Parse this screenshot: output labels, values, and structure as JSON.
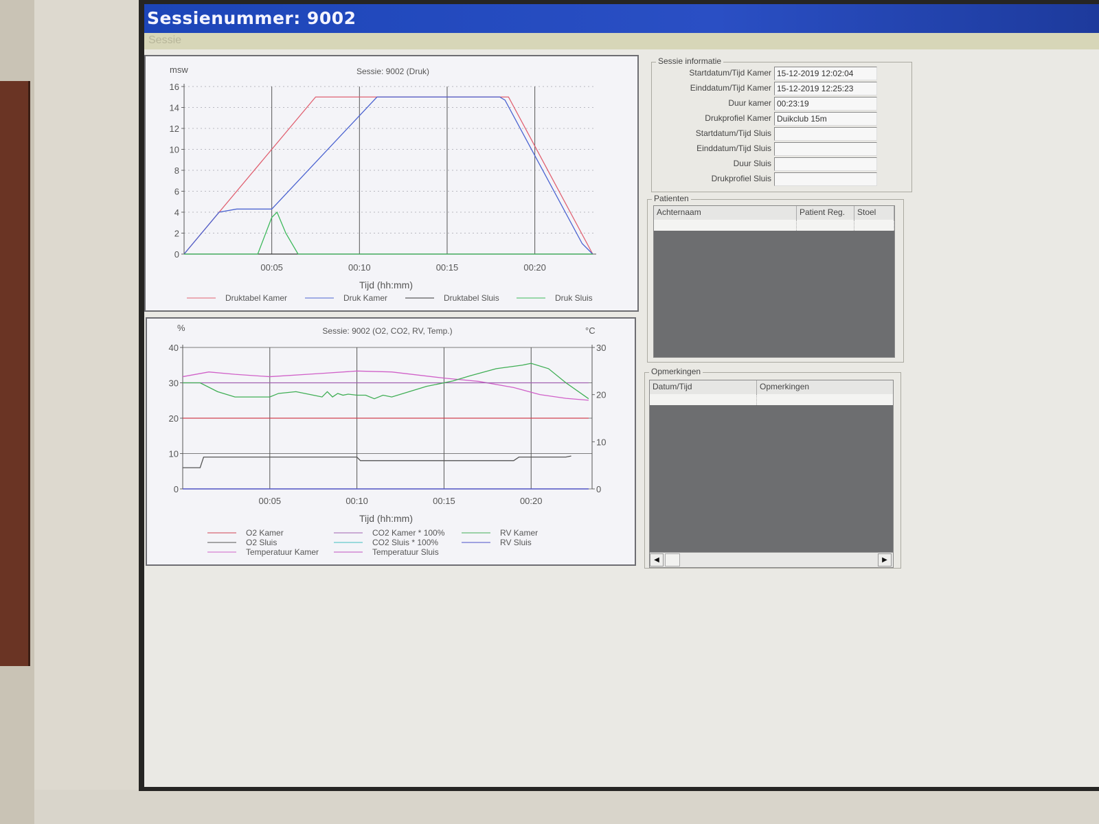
{
  "window": {
    "title": "Sessienummer: 9002"
  },
  "menu": {
    "items": [
      "Sessie"
    ]
  },
  "pressure_chart": {
    "title": "Sessie: 9002 (Druk)",
    "y_unit": "msw",
    "xlabel": "Tijd (hh:mm)",
    "y_ticks": [
      "0",
      "2",
      "4",
      "6",
      "8",
      "10",
      "12",
      "14",
      "16"
    ],
    "x_ticks": [
      "00:05",
      "00:10",
      "00:15",
      "00:20"
    ],
    "legend": [
      "Druktabel Kamer",
      "Druk Kamer",
      "Druktabel Sluis",
      "Druk Sluis"
    ]
  },
  "env_chart": {
    "title": "Sessie: 9002 (O2, CO2, RV, Temp.)",
    "y_unit_left": "%",
    "y_unit_right": "°C",
    "xlabel": "Tijd (hh:mm)",
    "y_ticks_left": [
      "0",
      "10",
      "20",
      "30",
      "40"
    ],
    "y_ticks_right": [
      "0",
      "10",
      "20",
      "30"
    ],
    "x_ticks": [
      "00:05",
      "00:10",
      "00:15",
      "00:20"
    ],
    "legend": [
      "O2 Kamer",
      "O2 Sluis",
      "Temperatuur Kamer",
      "CO2 Kamer * 100%",
      "CO2 Sluis * 100%",
      "Temperatuur Sluis",
      "RV Kamer",
      "RV Sluis"
    ]
  },
  "chart_data": [
    {
      "type": "line",
      "title": "Sessie: 9002 (Druk)",
      "xlabel": "Tijd (hh:mm)",
      "ylabel": "msw",
      "x_unit": "minutes",
      "xlim": [
        0,
        23.5
      ],
      "ylim": [
        0,
        16
      ],
      "grid": true,
      "legend_position": "bottom",
      "series": [
        {
          "name": "Druktabel Kamer",
          "color": "#e06070",
          "x": [
            0,
            7.5,
            18.5,
            23.3
          ],
          "y": [
            0,
            15,
            15,
            0
          ]
        },
        {
          "name": "Druk Kamer",
          "color": "#4a62d0",
          "x": [
            0,
            2,
            3,
            5,
            11,
            18,
            18.3,
            22.7,
            23.3
          ],
          "y": [
            0,
            4,
            4.3,
            4.3,
            15,
            15,
            14.7,
            1,
            0
          ]
        },
        {
          "name": "Druktabel Sluis",
          "color": "#333333",
          "x": [
            0,
            23.3
          ],
          "y": [
            0,
            0
          ]
        },
        {
          "name": "Druk Sluis",
          "color": "#3cb85a",
          "x": [
            0,
            4.2,
            5,
            5.3,
            5.8,
            6.5,
            23.3
          ],
          "y": [
            0,
            0,
            3.5,
            4,
            2,
            0,
            0
          ]
        }
      ]
    },
    {
      "type": "line",
      "title": "Sessie: 9002 (O2, CO2, RV, Temp.)",
      "xlabel": "Tijd (hh:mm)",
      "ylabel_left": "%",
      "ylabel_right": "°C",
      "x_unit": "minutes",
      "xlim": [
        0,
        23.5
      ],
      "ylim": [
        0,
        40
      ],
      "ylim_right": [
        0,
        30
      ],
      "grid": true,
      "legend_position": "bottom",
      "series": [
        {
          "name": "O2 Kamer",
          "color": "#d04050",
          "axis": "left",
          "x": [
            0,
            23.3
          ],
          "y": [
            20,
            20
          ]
        },
        {
          "name": "O2 Sluis",
          "color": "#555555",
          "axis": "left",
          "x": [
            0,
            1,
            1.2,
            10,
            10.2,
            19,
            19.3,
            22,
            22.3
          ],
          "y": [
            6,
            6,
            9,
            9,
            8,
            8,
            9,
            9,
            9.3
          ]
        },
        {
          "name": "Temperatuur Kamer",
          "color": "#d060c8",
          "axis": "right",
          "x": [
            0,
            1.5,
            3,
            5,
            8,
            10,
            12,
            15,
            17,
            19,
            20.5,
            22,
            23.3
          ],
          "y": [
            23.8,
            24.8,
            24.3,
            23.8,
            24.5,
            25,
            24.8,
            23.5,
            22.8,
            21.5,
            20,
            19.2,
            18.8
          ]
        },
        {
          "name": "CO2 Kamer * 100%",
          "color": "#a060b0",
          "axis": "left",
          "x": [
            0,
            23.3
          ],
          "y": [
            30,
            30
          ]
        },
        {
          "name": "CO2 Sluis * 100%",
          "color": "#40c0c0",
          "axis": "left",
          "x": [
            0,
            23.3
          ],
          "y": [
            0,
            0
          ]
        },
        {
          "name": "Temperatuur Sluis",
          "color": "#c050c0",
          "axis": "right",
          "x": [
            0,
            23.3
          ],
          "y": [
            0,
            0
          ]
        },
        {
          "name": "RV Kamer",
          "color": "#3fae54",
          "axis": "left",
          "x": [
            0,
            1,
            2,
            3,
            5,
            5.5,
            6.5,
            7.5,
            8,
            8.3,
            8.6,
            8.9,
            9.2,
            9.5,
            10,
            10.5,
            11,
            11.5,
            12,
            13,
            14,
            15.5,
            16.5,
            18,
            19.5,
            20,
            21,
            22,
            23.3
          ],
          "y": [
            30,
            30,
            27.5,
            26,
            26,
            27,
            27.5,
            26.5,
            26,
            27.5,
            26,
            27,
            26.5,
            26.8,
            26.5,
            26.5,
            25.5,
            26.5,
            26,
            27.5,
            29,
            30.5,
            32,
            34,
            35,
            35.5,
            34,
            30,
            25.5
          ]
        },
        {
          "name": "RV Sluis",
          "color": "#4a50c8",
          "axis": "left",
          "x": [
            0,
            23.3
          ],
          "y": [
            0,
            0
          ]
        }
      ]
    }
  ],
  "session_info": {
    "group_title": "Sessie informatie",
    "rows": [
      {
        "label": "Startdatum/Tijd Kamer",
        "value": "15-12-2019 12:02:04"
      },
      {
        "label": "Einddatum/Tijd Kamer",
        "value": "15-12-2019 12:25:23"
      },
      {
        "label": "Duur kamer",
        "value": "00:23:19"
      },
      {
        "label": "Drukprofiel Kamer",
        "value": "Duikclub 15m"
      },
      {
        "label": "Startdatum/Tijd Sluis",
        "value": ""
      },
      {
        "label": "Einddatum/Tijd Sluis",
        "value": ""
      },
      {
        "label": "Duur Sluis",
        "value": ""
      },
      {
        "label": "Drukprofiel Sluis",
        "value": ""
      }
    ]
  },
  "patients": {
    "group_title": "Patienten",
    "columns": [
      "Achternaam",
      "Patient Reg.",
      "Stoel"
    ]
  },
  "remarks": {
    "group_title": "Opmerkingen",
    "columns": [
      "Datum/Tijd",
      "Opmerkingen"
    ]
  }
}
